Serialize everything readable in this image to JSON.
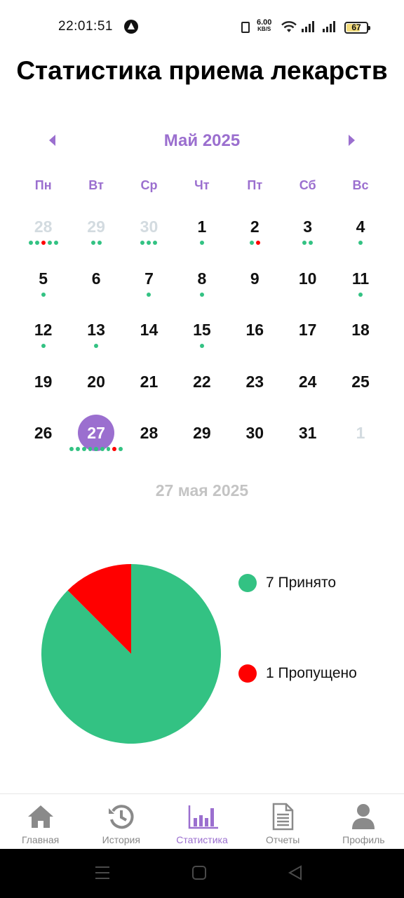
{
  "status_bar": {
    "time": "22:01:51",
    "net_speed_value": "6.00",
    "net_speed_unit": "KB/S",
    "battery_level": 67,
    "battery_text": "67",
    "icons": [
      "vibrate-icon",
      "wifi-icon",
      "signal-icon",
      "battery-icon"
    ]
  },
  "page_title": "Статистика приема лекарств",
  "calendar": {
    "month_title": "Май 2025",
    "weekdays": [
      "Пн",
      "Вт",
      "Ср",
      "Чт",
      "Пт",
      "Сб",
      "Вс"
    ],
    "selected_day": 27,
    "days": [
      {
        "day": "28",
        "other_month": true,
        "dots": [
          "g",
          "g",
          "r",
          "g",
          "g"
        ]
      },
      {
        "day": "29",
        "other_month": true,
        "dots": [
          "g",
          "g"
        ]
      },
      {
        "day": "30",
        "other_month": true,
        "dots": [
          "g",
          "g",
          "g"
        ]
      },
      {
        "day": "1",
        "other_month": false,
        "dots": [
          "g"
        ]
      },
      {
        "day": "2",
        "other_month": false,
        "dots": [
          "g",
          "r"
        ]
      },
      {
        "day": "3",
        "other_month": false,
        "dots": [
          "g",
          "g"
        ]
      },
      {
        "day": "4",
        "other_month": false,
        "dots": [
          "g"
        ]
      },
      {
        "day": "5",
        "other_month": false,
        "dots": [
          "g"
        ]
      },
      {
        "day": "6",
        "other_month": false,
        "dots": []
      },
      {
        "day": "7",
        "other_month": false,
        "dots": [
          "g"
        ]
      },
      {
        "day": "8",
        "other_month": false,
        "dots": [
          "g"
        ]
      },
      {
        "day": "9",
        "other_month": false,
        "dots": []
      },
      {
        "day": "10",
        "other_month": false,
        "dots": []
      },
      {
        "day": "11",
        "other_month": false,
        "dots": [
          "g"
        ]
      },
      {
        "day": "12",
        "other_month": false,
        "dots": [
          "g"
        ]
      },
      {
        "day": "13",
        "other_month": false,
        "dots": [
          "g"
        ]
      },
      {
        "day": "14",
        "other_month": false,
        "dots": []
      },
      {
        "day": "15",
        "other_month": false,
        "dots": [
          "g"
        ]
      },
      {
        "day": "16",
        "other_month": false,
        "dots": []
      },
      {
        "day": "17",
        "other_month": false,
        "dots": []
      },
      {
        "day": "18",
        "other_month": false,
        "dots": []
      },
      {
        "day": "19",
        "other_month": false,
        "dots": []
      },
      {
        "day": "20",
        "other_month": false,
        "dots": []
      },
      {
        "day": "21",
        "other_month": false,
        "dots": []
      },
      {
        "day": "22",
        "other_month": false,
        "dots": []
      },
      {
        "day": "23",
        "other_month": false,
        "dots": []
      },
      {
        "day": "24",
        "other_month": false,
        "dots": []
      },
      {
        "day": "25",
        "other_month": false,
        "dots": []
      },
      {
        "day": "26",
        "other_month": false,
        "dots": []
      },
      {
        "day": "27",
        "other_month": false,
        "selected": true,
        "dots": [
          "g",
          "g",
          "g",
          "g",
          "g",
          "g",
          "g",
          "r",
          "g"
        ]
      },
      {
        "day": "28",
        "other_month": false,
        "dots": []
      },
      {
        "day": "29",
        "other_month": false,
        "dots": []
      },
      {
        "day": "30",
        "other_month": false,
        "dots": []
      },
      {
        "day": "31",
        "other_month": false,
        "dots": []
      },
      {
        "day": "1",
        "other_month": true,
        "dots": []
      }
    ]
  },
  "selected_date_label": "27 мая 2025",
  "colors": {
    "accent": "#9b6fcf",
    "taken": "#33c283",
    "missed": "#ff0000",
    "muted_text": "#c4c4c4",
    "other_month": "#d3dbe0"
  },
  "chart_data": {
    "type": "pie",
    "slices": [
      {
        "label": "Принято",
        "value": 7,
        "color": "#33c283"
      },
      {
        "label": "Пропущено",
        "value": 1,
        "color": "#ff0000"
      }
    ]
  },
  "legend": {
    "items": [
      {
        "text": "7 Принято",
        "color": "#33c283"
      },
      {
        "text": "1 Пропущено",
        "color": "#ff0000"
      }
    ]
  },
  "bottom_nav": {
    "active": "Статистика",
    "items": [
      {
        "label": "Главная",
        "icon": "home-icon"
      },
      {
        "label": "История",
        "icon": "history-icon"
      },
      {
        "label": "Статистика",
        "icon": "bar-chart-icon"
      },
      {
        "label": "Отчеты",
        "icon": "document-icon"
      },
      {
        "label": "Профиль",
        "icon": "profile-icon"
      }
    ]
  },
  "system_nav": {
    "buttons": [
      "menu-icon",
      "home-square-icon",
      "back-triangle-icon"
    ]
  }
}
